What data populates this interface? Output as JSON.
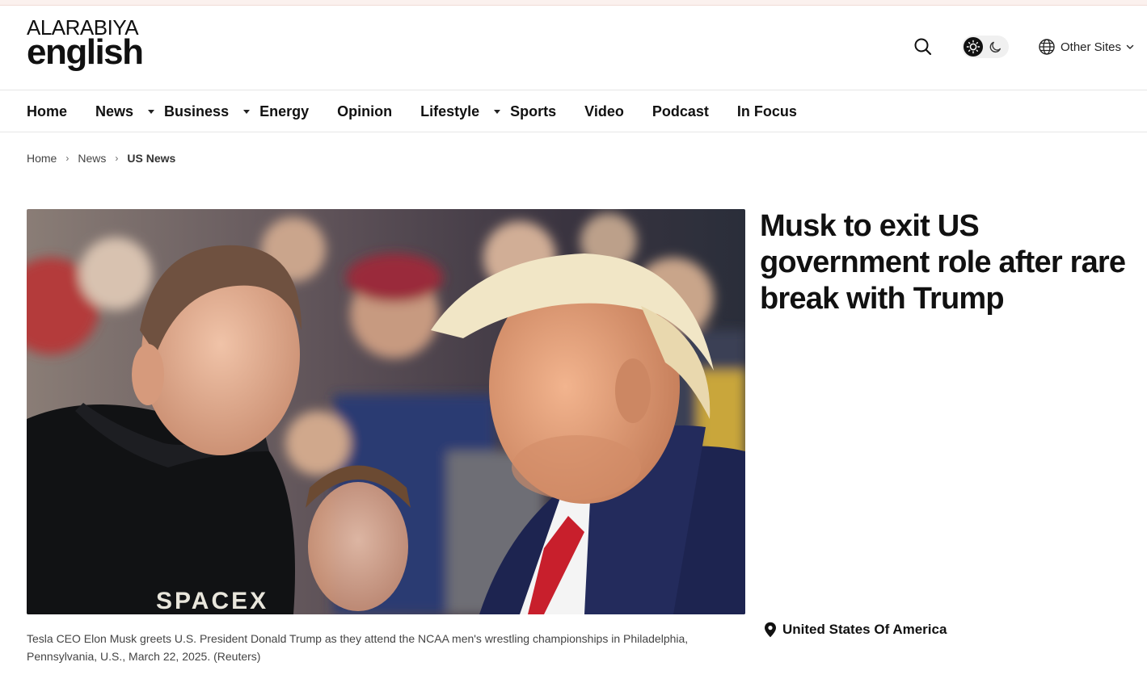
{
  "header": {
    "brand_top": "ALARABIYA",
    "brand_bottom": "english",
    "other_sites_label": "Other Sites"
  },
  "nav": {
    "items": [
      {
        "label": "Home",
        "has_dropdown": false
      },
      {
        "label": "News",
        "has_dropdown": true
      },
      {
        "label": "Business",
        "has_dropdown": true
      },
      {
        "label": "Energy",
        "has_dropdown": false
      },
      {
        "label": "Opinion",
        "has_dropdown": false
      },
      {
        "label": "Lifestyle",
        "has_dropdown": true
      },
      {
        "label": "Sports",
        "has_dropdown": false
      },
      {
        "label": "Video",
        "has_dropdown": false
      },
      {
        "label": "Podcast",
        "has_dropdown": false
      },
      {
        "label": "In Focus",
        "has_dropdown": false
      }
    ]
  },
  "breadcrumb": {
    "items": [
      "Home",
      "News"
    ],
    "current": "US News"
  },
  "article": {
    "headline": "Musk to exit US government role after rare break with Trump",
    "caption": "Tesla CEO Elon Musk greets U.S. President Donald Trump as they attend the NCAA men's wrestling championships in Philadelphia, Pennsylvania, U.S., March 22, 2025. (Reuters)",
    "location": "United States Of America",
    "shirt_logo_text": "SPACEX"
  },
  "icons": {
    "search": "search-icon",
    "theme_light": "sun-icon",
    "theme_dark": "moon-icon",
    "globe": "globe-icon",
    "chevron": "chevron-down-icon",
    "location": "location-pin-icon"
  },
  "colors": {
    "text": "#111111",
    "border": "#e6e6e6",
    "top_strip": "#fbf1ee",
    "toggle_bg": "#f0f0f0"
  }
}
